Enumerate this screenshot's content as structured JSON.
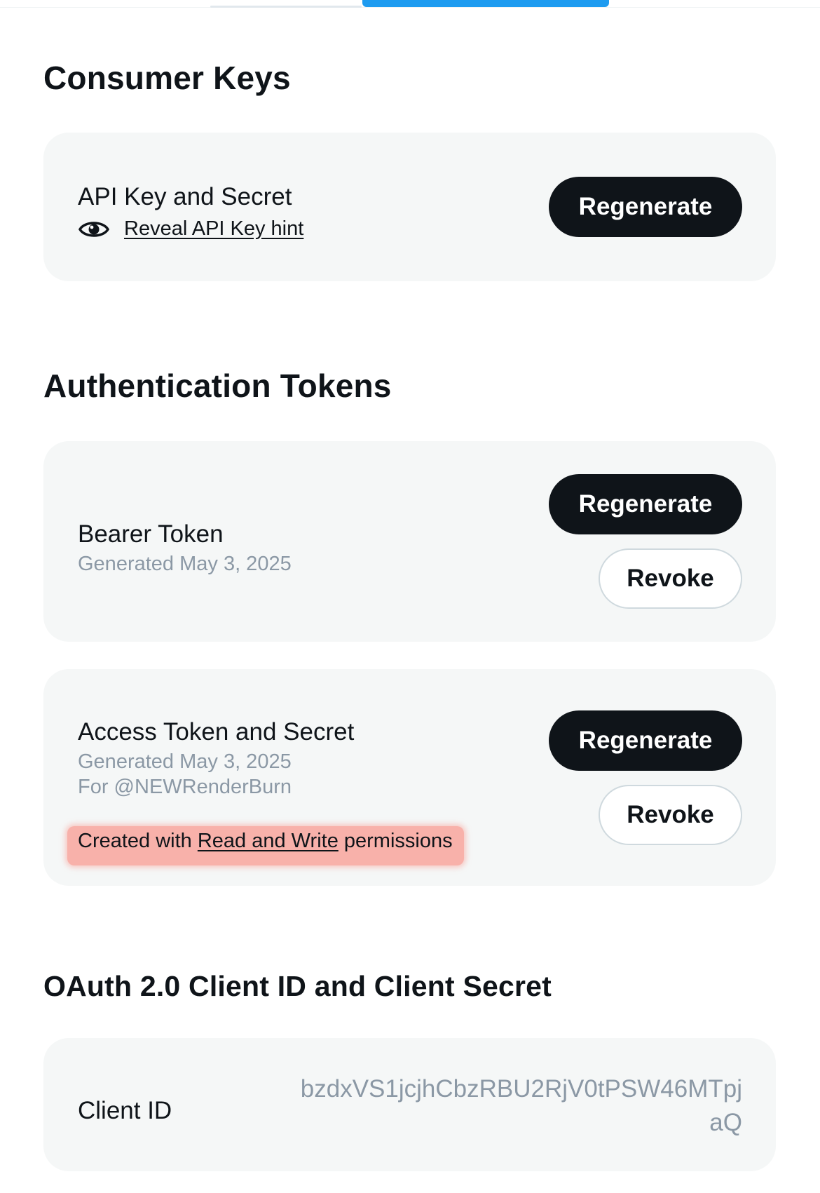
{
  "consumer_keys": {
    "title": "Consumer Keys",
    "api_key": {
      "title": "API Key and Secret",
      "reveal_link": "Reveal API Key hint",
      "regenerate_label": "Regenerate"
    }
  },
  "auth_tokens": {
    "title": "Authentication Tokens",
    "bearer": {
      "title": "Bearer Token",
      "generated": "Generated May 3, 2025",
      "regenerate_label": "Regenerate",
      "revoke_label": "Revoke"
    },
    "access": {
      "title": "Access Token and Secret",
      "generated": "Generated May 3, 2025",
      "for_user": "For @NEWRenderBurn",
      "permission_prefix": "Created with ",
      "permission_link": "Read and Write",
      "permission_suffix": " permissions",
      "regenerate_label": "Regenerate",
      "revoke_label": "Revoke"
    }
  },
  "oauth2": {
    "title": "OAuth 2.0 Client ID and Client Secret",
    "client_id_label": "Client ID",
    "client_id_value": "bzdxVS1jcjhCbzRBU2RjV0tPSW46MTpjaQ"
  },
  "colors": {
    "accent": "#1d9bf0",
    "button_dark": "#0f1419",
    "card_bg": "#f5f7f7",
    "muted_text": "#8b98a5",
    "highlight": "#f8b1aa"
  }
}
